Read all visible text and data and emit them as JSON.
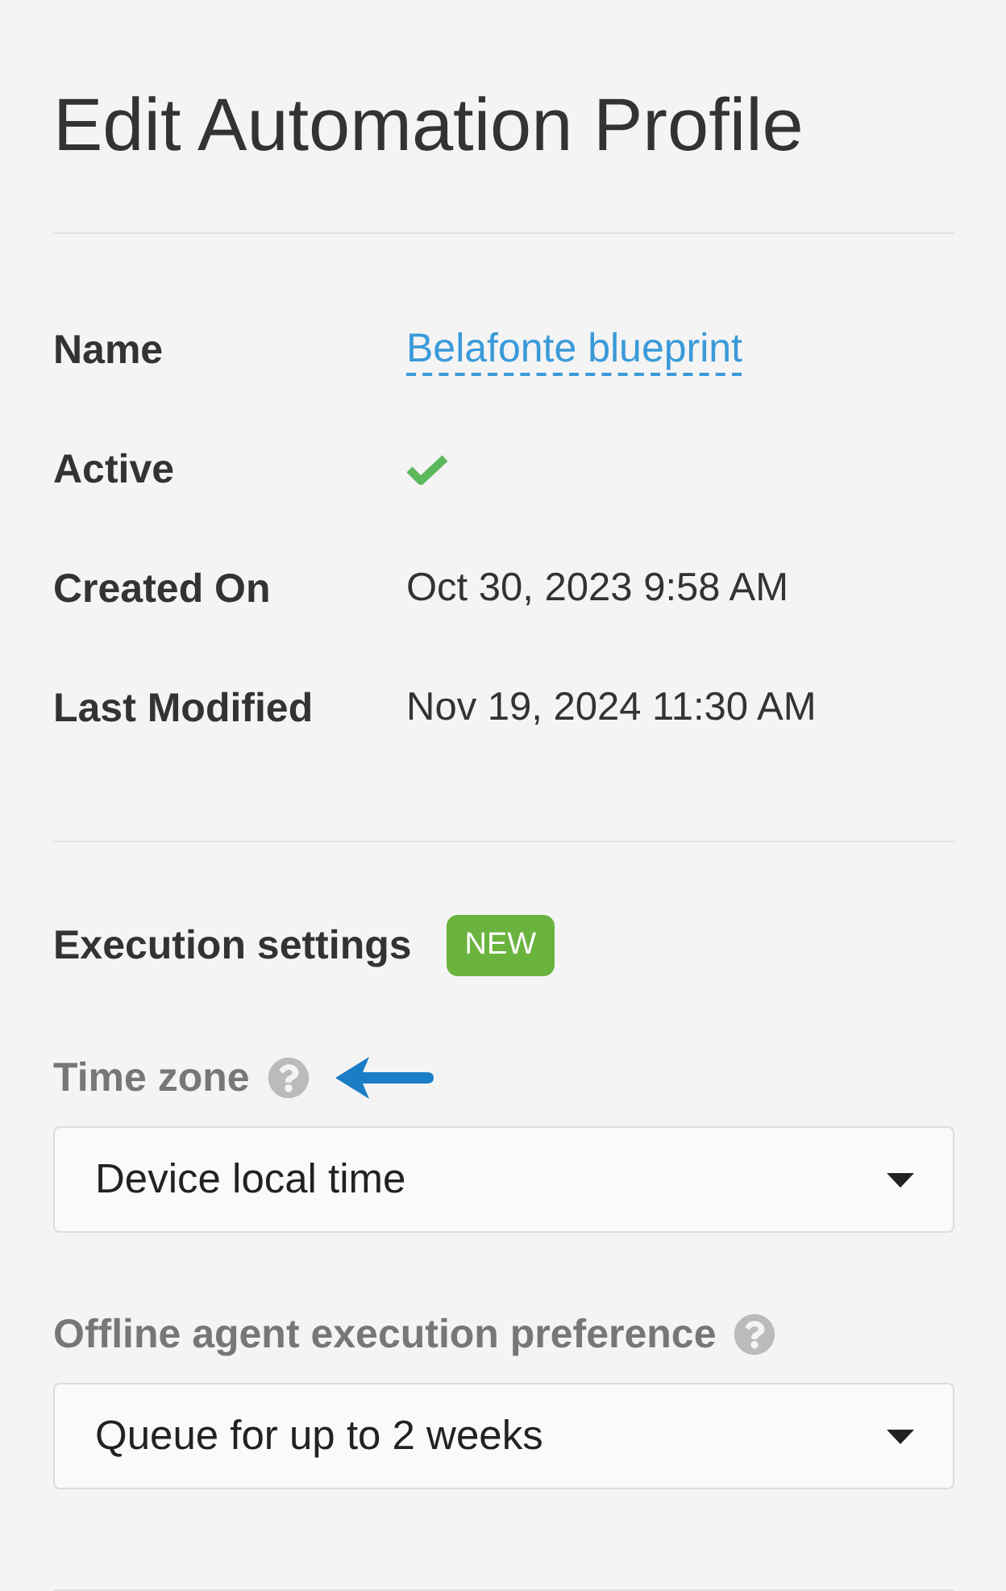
{
  "page": {
    "title": "Edit Automation Profile"
  },
  "details": [
    {
      "kind": "link",
      "label": "Name",
      "value": "Belafonte blueprint"
    },
    {
      "kind": "check",
      "label": "Active",
      "checked": true
    },
    {
      "kind": "text",
      "label": "Created On",
      "value": "Oct 30, 2023 9:58 AM"
    },
    {
      "kind": "text",
      "label": "Last Modified",
      "value": "Nov 19, 2024 11:30 AM"
    }
  ],
  "execution_settings": {
    "title": "Execution settings",
    "badge": "NEW",
    "fields": [
      {
        "label": "Time zone",
        "help": true,
        "callout_arrow": true,
        "value": "Device local time"
      },
      {
        "label": "Offline agent execution preference",
        "help": true,
        "callout_arrow": false,
        "value": "Queue for up to 2 weeks"
      }
    ]
  }
}
